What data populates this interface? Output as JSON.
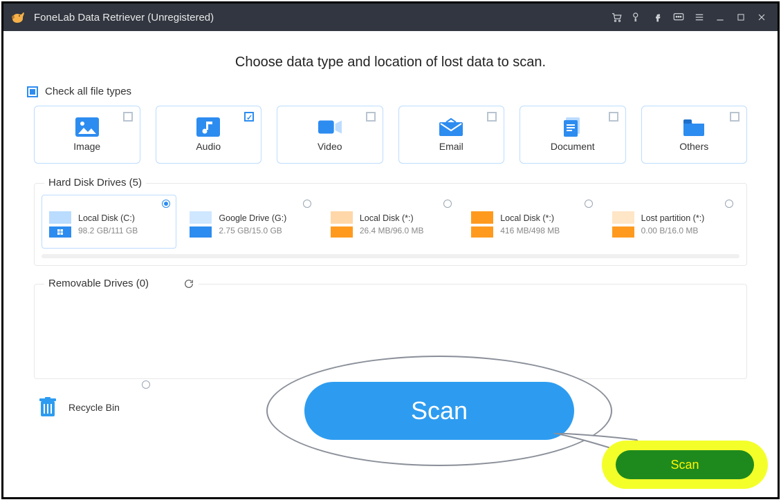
{
  "title": "FoneLab Data Retriever (Unregistered)",
  "heading": "Choose data type and location of lost data to scan.",
  "check_all_label": "Check all file types",
  "types": [
    {
      "label": "Image",
      "checked": false
    },
    {
      "label": "Audio",
      "checked": true
    },
    {
      "label": "Video",
      "checked": false
    },
    {
      "label": "Email",
      "checked": false
    },
    {
      "label": "Document",
      "checked": false
    },
    {
      "label": "Others",
      "checked": false
    }
  ],
  "hdd_legend": "Hard Disk Drives (5)",
  "drives": [
    {
      "name": "Local Disk (C:)",
      "size": "98.2 GB/111 GB",
      "icon_top": "#b9dcff",
      "icon_bot": "#2d8cf0",
      "selected": true
    },
    {
      "name": "Google Drive (G:)",
      "size": "2.75 GB/15.0 GB",
      "icon_top": "#cfe7ff",
      "icon_bot": "#2d8cf0",
      "selected": false
    },
    {
      "name": "Local Disk (*:)",
      "size": "26.4 MB/96.0 MB",
      "icon_top": "#ffd7a8",
      "icon_bot": "#ff9a1f",
      "selected": false
    },
    {
      "name": "Local Disk (*:)",
      "size": "416 MB/498 MB",
      "icon_top": "#ff9a1f",
      "icon_bot": "#ff9a1f",
      "selected": false
    },
    {
      "name": "Lost partition (*:)",
      "size": "0.00  B/16.0 MB",
      "icon_top": "#ffe6c7",
      "icon_bot": "#ff9a1f",
      "selected": false
    }
  ],
  "removable_legend": "Removable Drives (0)",
  "recycle_label": "Recycle Bin",
  "scan_big_label": "Scan",
  "scan_small_label": "Scan"
}
